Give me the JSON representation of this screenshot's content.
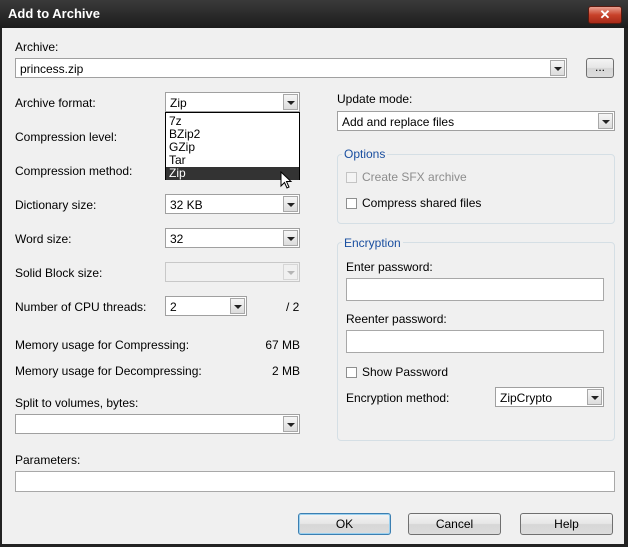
{
  "window": {
    "title": "Add to Archive",
    "close_glyph": "✕"
  },
  "archive": {
    "label": "Archive:",
    "value": "princess.zip",
    "browse_label": "..."
  },
  "left": {
    "format_label": "Archive format:",
    "format_value": "Zip",
    "format_options": [
      "7z",
      "BZip2",
      "GZip",
      "Tar",
      "Zip"
    ],
    "format_selected": "Zip",
    "level_label": "Compression level:",
    "method_label": "Compression method:",
    "dict_label": "Dictionary size:",
    "dict_value": "32 KB",
    "word_label": "Word size:",
    "word_value": "32",
    "solid_label": "Solid Block size:",
    "solid_value": "",
    "threads_label": "Number of CPU threads:",
    "threads_value": "2",
    "threads_total": "/ 2",
    "mem_compress_label": "Memory usage for Compressing:",
    "mem_compress_value": "67 MB",
    "mem_decompress_label": "Memory usage for Decompressing:",
    "mem_decompress_value": "2 MB",
    "split_label": "Split to volumes, bytes:",
    "split_value": "",
    "params_label": "Parameters:",
    "params_value": ""
  },
  "right": {
    "update_label": "Update mode:",
    "update_value": "Add and replace files",
    "options_title": "Options",
    "sfx_label": "Create SFX archive",
    "sfx_checked": false,
    "shared_label": "Compress shared files",
    "shared_checked": false,
    "enc_title": "Encryption",
    "enter_pw_label": "Enter password:",
    "enter_pw_value": "",
    "reenter_pw_label": "Reenter password:",
    "reenter_pw_value": "",
    "show_pw_label": "Show Password",
    "show_pw_checked": false,
    "enc_method_label": "Encryption method:",
    "enc_method_value": "ZipCrypto"
  },
  "buttons": {
    "ok": "OK",
    "cancel": "Cancel",
    "help": "Help"
  },
  "colors": {
    "title_bar": "#1c1c1c",
    "close_button": "#c8412a",
    "group_title": "#1a4fa0",
    "selection": "#333333"
  }
}
